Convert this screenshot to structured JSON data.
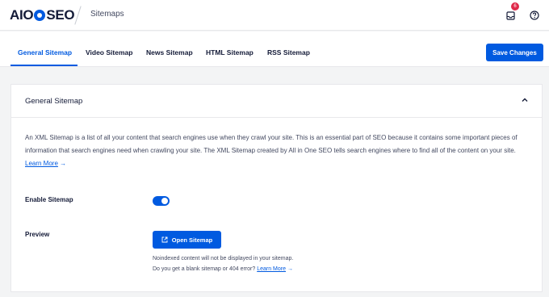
{
  "header": {
    "logo_left": "AIO",
    "logo_right": "SEO",
    "breadcrumb": "Sitemaps",
    "notification_count": "6",
    "icons": [
      "inbox-icon",
      "help-icon"
    ]
  },
  "tabs": [
    {
      "label": "General Sitemap",
      "active": true
    },
    {
      "label": "Video Sitemap",
      "active": false
    },
    {
      "label": "News Sitemap",
      "active": false
    },
    {
      "label": "HTML Sitemap",
      "active": false
    },
    {
      "label": "RSS Sitemap",
      "active": false
    }
  ],
  "toolbar": {
    "save_label": "Save Changes"
  },
  "card": {
    "title": "General Sitemap",
    "description": "An XML Sitemap is a list of all your content that search engines use when they crawl your site. This is an essential part of SEO because it contains some important pieces of information that search engines need when crawling your site. The XML Sitemap created by All in One SEO tells search engines where to find all of the content on your site.",
    "learn_more": "Learn More",
    "arrow": "→",
    "enable_label": "Enable Sitemap",
    "enable_on": true,
    "preview_label": "Preview",
    "open_button": "Open Sitemap",
    "note1": "Noindexed content will not be displayed in your sitemap.",
    "note2": "Do you get a blank sitemap or 404 error?",
    "note2_link": "Learn More"
  },
  "colors": {
    "accent": "#005ae0",
    "badge": "#df2a4a",
    "background": "#f3f4f5",
    "text": "#141b38"
  }
}
